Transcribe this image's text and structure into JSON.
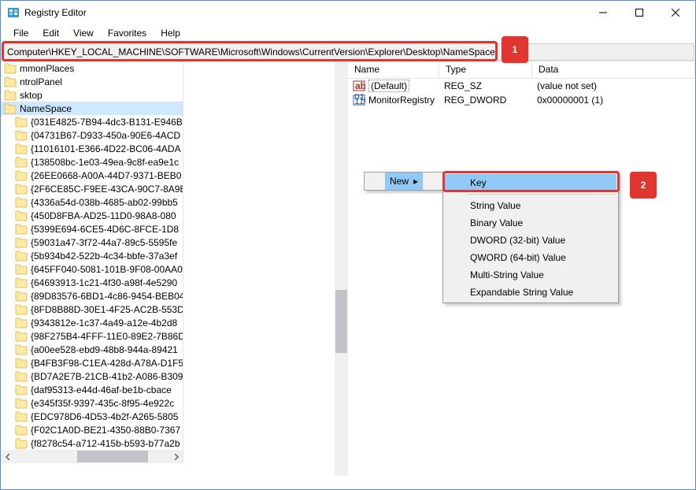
{
  "window": {
    "title": "Registry Editor"
  },
  "menubar": {
    "file": "File",
    "edit": "Edit",
    "view": "View",
    "favorites": "Favorites",
    "help": "Help"
  },
  "addressbar": {
    "value": "Computer\\HKEY_LOCAL_MACHINE\\SOFTWARE\\Microsoft\\Windows\\CurrentVersion\\Explorer\\Desktop\\NameSpace"
  },
  "callouts": {
    "one": "1",
    "two": "2"
  },
  "tree": {
    "top": [
      {
        "label": "mmonPlaces",
        "indent": false
      },
      {
        "label": "ntrolPanel",
        "indent": false
      },
      {
        "label": "sktop",
        "indent": false
      },
      {
        "label": "NameSpace",
        "indent": false,
        "selected": true
      }
    ],
    "children": [
      "{031E4825-7B94-4dc3-B131-E946B",
      "{04731B67-D933-450a-90E6-4ACD",
      "{11016101-E366-4D22-BC06-4ADA",
      "{138508bc-1e03-49ea-9c8f-ea9e1c",
      "{26EE0668-A00A-44D7-9371-BEB0",
      "{2F6CE85C-F9EE-43CA-90C7-8A9B",
      "{4336a54d-038b-4685-ab02-99bb5",
      "{450D8FBA-AD25-11D0-98A8-080",
      "{5399E694-6CE5-4D6C-8FCE-1D8",
      "{59031a47-3f72-44a7-89c5-5595fe",
      "{5b934b42-522b-4c34-bbfe-37a3ef",
      "{645FF040-5081-101B-9F08-00AA0",
      "{64693913-1c21-4f30-a98f-4e5290",
      "{89D83576-6BD1-4c86-9454-BEB04",
      "{8FD8B88D-30E1-4F25-AC2B-553D",
      "{9343812e-1c37-4a49-a12e-4b2d8",
      "{98F275B4-4FFF-11E0-89E2-7B86D",
      "{a00ee528-ebd9-48b8-944a-89421",
      "{B4FB3F98-C1EA-428d-A78A-D1F5",
      "{BD7A2E7B-21CB-41b2-A086-B309",
      "{daf95313-e44d-46af-be1b-cbace",
      "{e345f35f-9397-435c-8f95-4e922c",
      "{EDC978D6-4D53-4b2f-A265-5805",
      "{F02C1A0D-BE21-4350-88B0-7367",
      "{f8278c54-a712-415b-b593-b77a2b"
    ]
  },
  "list": {
    "cols": {
      "name": "Name",
      "type": "Type",
      "data": "Data"
    },
    "rows": [
      {
        "icon": "string",
        "name": "(Default)",
        "type": "REG_SZ",
        "data": "(value not set)",
        "default": true
      },
      {
        "icon": "binary",
        "name": "MonitorRegistry",
        "type": "REG_DWORD",
        "data": "0x00000001 (1)",
        "default": false
      }
    ]
  },
  "context": {
    "new": "New",
    "items": [
      "Key",
      "String Value",
      "Binary Value",
      "DWORD (32-bit) Value",
      "QWORD (64-bit) Value",
      "Multi-String Value",
      "Expandable String Value"
    ]
  }
}
